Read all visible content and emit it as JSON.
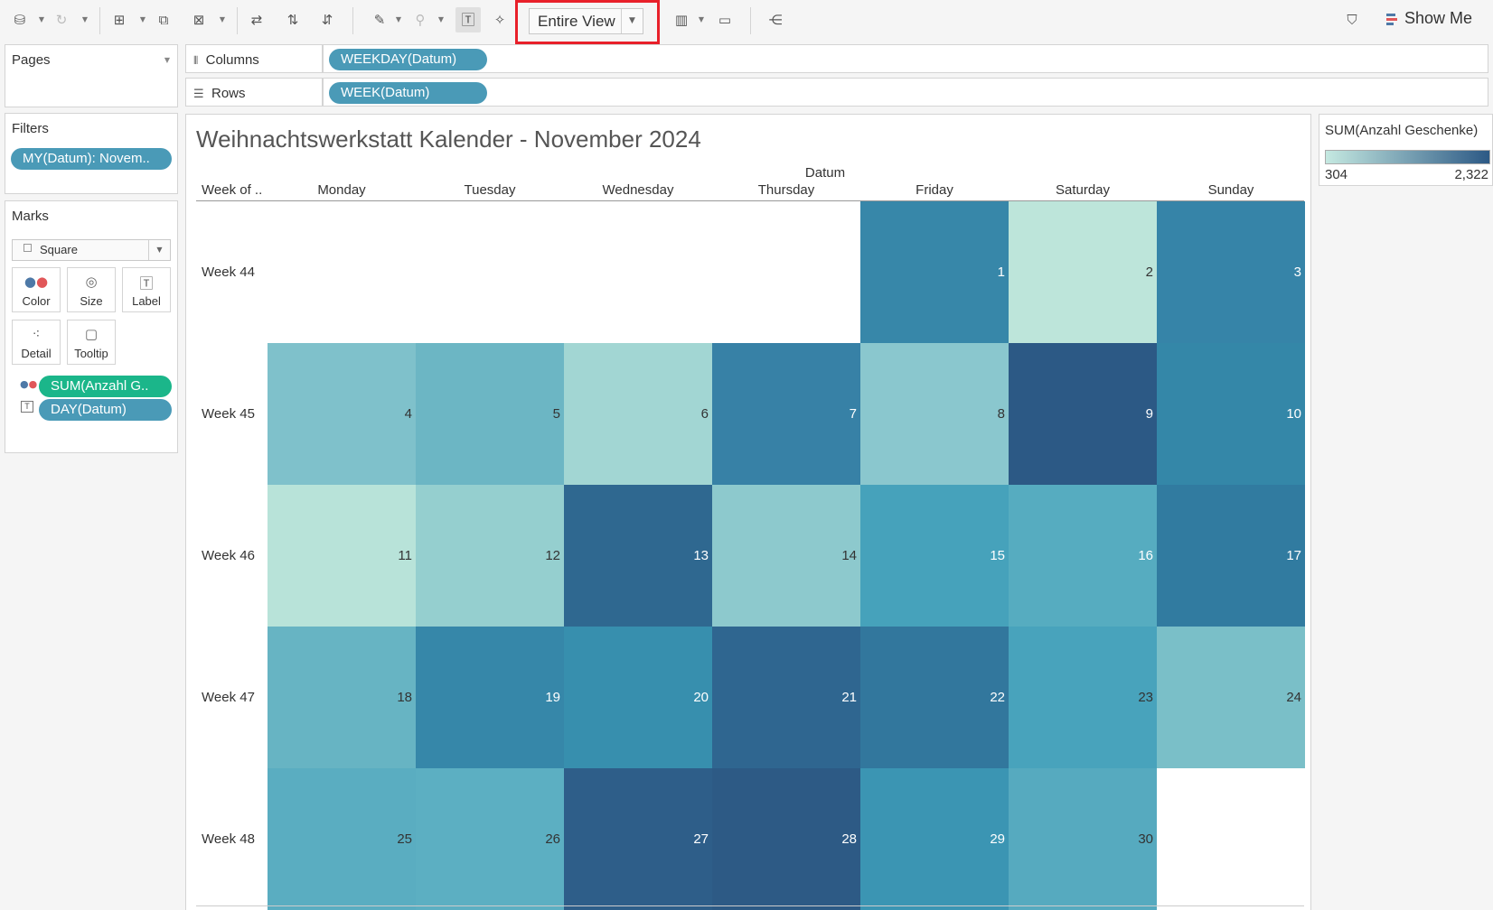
{
  "toolbar": {
    "fit_value": "Entire View",
    "show_me_label": "Show Me",
    "show_me_colors": [
      "#4e79a7",
      "#e15759",
      "#4e79a7"
    ]
  },
  "left_panels": {
    "pages_title": "Pages",
    "filters_title": "Filters",
    "filter_pill": "MY(Datum): Novem..",
    "marks_title": "Marks",
    "mark_type": "Square",
    "mark_buttons": [
      "Color",
      "Size",
      "Label",
      "Detail",
      "Tooltip"
    ],
    "mark_pills": [
      "SUM(Anzahl G..",
      "DAY(Datum)"
    ]
  },
  "shelves": {
    "columns_label": "Columns",
    "columns_pill": "WEEKDAY(Datum)",
    "rows_label": "Rows",
    "rows_pill": "WEEK(Datum)"
  },
  "viz": {
    "title": "Weihnachtswerkstatt Kalender - November 2024",
    "column_group_header": "Datum",
    "row_header_title": "Week of ..",
    "weekdays": [
      "Monday",
      "Tuesday",
      "Wednesday",
      "Thursday",
      "Friday",
      "Saturday",
      "Sunday"
    ],
    "weeks": [
      "Week 44",
      "Week 45",
      "Week 46",
      "Week 47",
      "Week 48"
    ]
  },
  "legend": {
    "title": "SUM(Anzahl Geschenke)",
    "min_label": "304",
    "max_label": "2,322",
    "color_low": "#c5e9e1",
    "color_high": "#2c5985"
  },
  "chart_data": {
    "type": "heatmap",
    "title": "Weihnachtswerkstatt Kalender - November 2024",
    "x_categories": [
      "Monday",
      "Tuesday",
      "Wednesday",
      "Thursday",
      "Friday",
      "Saturday",
      "Sunday"
    ],
    "y_categories": [
      "Week 44",
      "Week 45",
      "Week 46",
      "Week 47",
      "Week 48"
    ],
    "cells": [
      {
        "day": 1,
        "week": "Week 44",
        "weekday": "Friday",
        "color": "#3787a9"
      },
      {
        "day": 2,
        "week": "Week 44",
        "weekday": "Saturday",
        "color": "#bde5da"
      },
      {
        "day": 3,
        "week": "Week 44",
        "weekday": "Sunday",
        "color": "#3684a8"
      },
      {
        "day": 4,
        "week": "Week 45",
        "weekday": "Monday",
        "color": "#7fc1cb"
      },
      {
        "day": 5,
        "week": "Week 45",
        "weekday": "Tuesday",
        "color": "#6cb6c4"
      },
      {
        "day": 6,
        "week": "Week 45",
        "weekday": "Wednesday",
        "color": "#a2d6d3"
      },
      {
        "day": 7,
        "week": "Week 45",
        "weekday": "Thursday",
        "color": "#3781a6"
      },
      {
        "day": 8,
        "week": "Week 45",
        "weekday": "Friday",
        "color": "#8ac7ce"
      },
      {
        "day": 9,
        "week": "Week 45",
        "weekday": "Saturday",
        "color": "#2c5985"
      },
      {
        "day": 10,
        "week": "Week 45",
        "weekday": "Sunday",
        "color": "#3487a8"
      },
      {
        "day": 11,
        "week": "Week 46",
        "weekday": "Monday",
        "color": "#b8e3d9"
      },
      {
        "day": 12,
        "week": "Week 46",
        "weekday": "Tuesday",
        "color": "#95cfcf"
      },
      {
        "day": 13,
        "week": "Week 46",
        "weekday": "Wednesday",
        "color": "#2f6890"
      },
      {
        "day": 14,
        "week": "Week 46",
        "weekday": "Thursday",
        "color": "#8dc9cd"
      },
      {
        "day": 15,
        "week": "Week 46",
        "weekday": "Friday",
        "color": "#46a2bb"
      },
      {
        "day": 16,
        "week": "Week 46",
        "weekday": "Saturday",
        "color": "#56acc0"
      },
      {
        "day": 17,
        "week": "Week 46",
        "weekday": "Sunday",
        "color": "#317ba0"
      },
      {
        "day": 18,
        "week": "Week 47",
        "weekday": "Monday",
        "color": "#67b4c3"
      },
      {
        "day": 19,
        "week": "Week 47",
        "weekday": "Tuesday",
        "color": "#3687a9"
      },
      {
        "day": 20,
        "week": "Week 47",
        "weekday": "Wednesday",
        "color": "#378fae"
      },
      {
        "day": 21,
        "week": "Week 47",
        "weekday": "Thursday",
        "color": "#2f6690"
      },
      {
        "day": 22,
        "week": "Week 47",
        "weekday": "Friday",
        "color": "#32779d"
      },
      {
        "day": 23,
        "week": "Week 47",
        "weekday": "Saturday",
        "color": "#48a3bc"
      },
      {
        "day": 24,
        "week": "Week 47",
        "weekday": "Sunday",
        "color": "#7abfc8"
      },
      {
        "day": 25,
        "week": "Week 48",
        "weekday": "Monday",
        "color": "#5aadc1"
      },
      {
        "day": 26,
        "week": "Week 48",
        "weekday": "Tuesday",
        "color": "#5cafc2"
      },
      {
        "day": 27,
        "week": "Week 48",
        "weekday": "Wednesday",
        "color": "#2e5e89"
      },
      {
        "day": 28,
        "week": "Week 48",
        "weekday": "Thursday",
        "color": "#2d5a85"
      },
      {
        "day": 29,
        "week": "Week 48",
        "weekday": "Friday",
        "color": "#3b95b3"
      },
      {
        "day": 30,
        "week": "Week 48",
        "weekday": "Saturday",
        "color": "#56aabf"
      }
    ],
    "color_legend": {
      "title": "SUM(Anzahl Geschenke)",
      "min": 304,
      "max": 2322
    },
    "light_text_days": [
      1,
      3,
      7,
      9,
      10,
      13,
      15,
      16,
      17,
      19,
      20,
      21,
      22,
      27,
      28,
      29
    ]
  }
}
